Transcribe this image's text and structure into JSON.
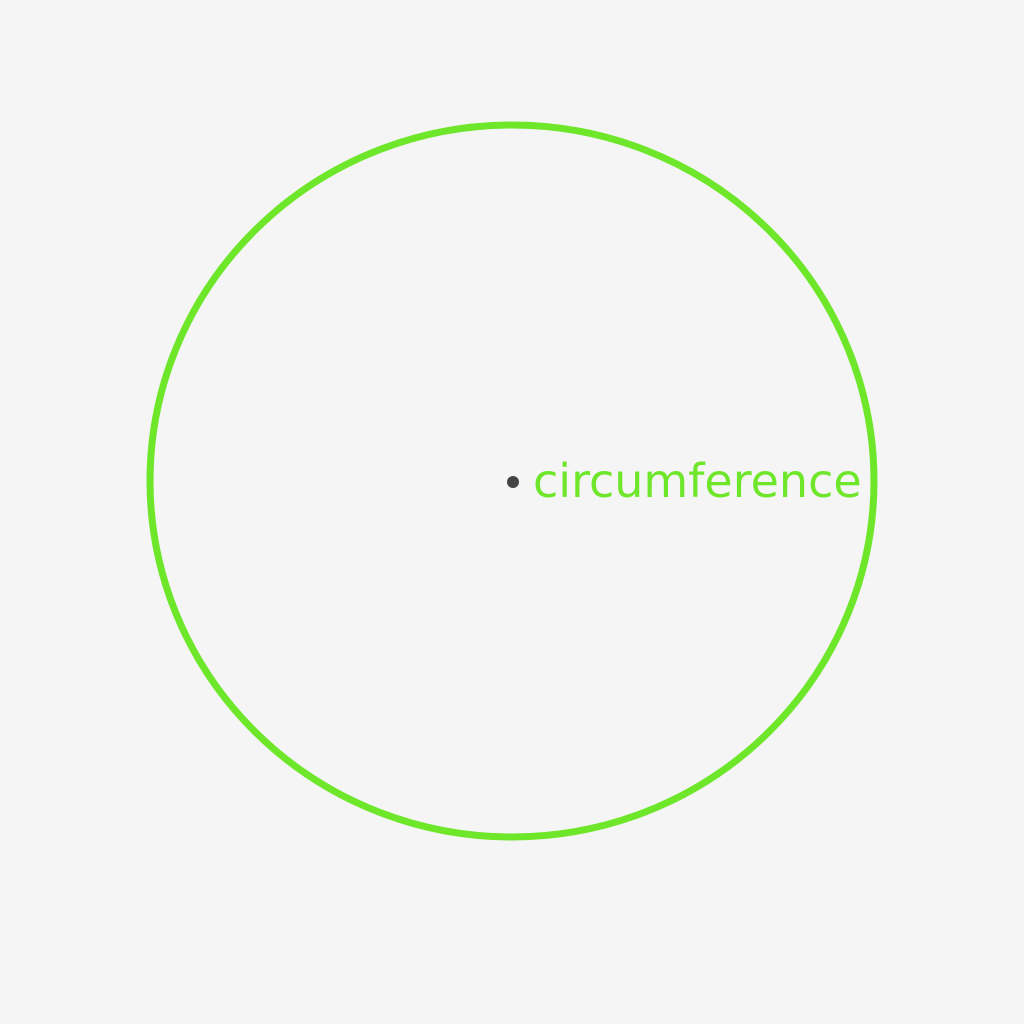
{
  "diagram": {
    "label": "circumference",
    "colors": {
      "background": "#f5f5f5",
      "circle_stroke": "#6ee62a",
      "label": "#6ee62a",
      "center_dot": "#444444"
    }
  }
}
